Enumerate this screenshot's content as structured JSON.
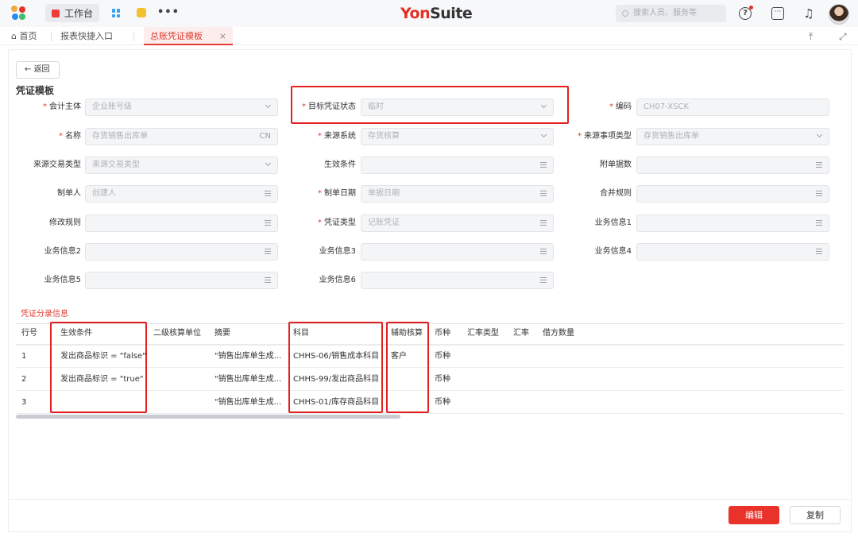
{
  "topbar": {
    "workbench": "工作台",
    "more": "•••",
    "brand_main": "Yon",
    "brand_sub": "Suite",
    "search_placeholder": "搜索人员、服务等"
  },
  "tabs": [
    {
      "label": "首页"
    },
    {
      "label": "报表快捷入口"
    },
    {
      "label": "总账凭证模板"
    }
  ],
  "page": {
    "back": "返回",
    "section_title": "凭证模板",
    "subsection_title": "凭证分录信息"
  },
  "form": [
    {
      "label": "会计主体",
      "required": true,
      "value": "企业账号级",
      "control": "select"
    },
    {
      "label": "目标凭证状态",
      "required": true,
      "value": "临时",
      "control": "select"
    },
    {
      "label": "编码",
      "required": true,
      "value": "CH07-XSCK",
      "control": "text"
    },
    {
      "label": "名称",
      "required": true,
      "value": "存货销售出库单",
      "suffix": "CN",
      "control": "text"
    },
    {
      "label": "来源系统",
      "required": true,
      "value": "存货核算",
      "control": "select"
    },
    {
      "label": "来源事项类型",
      "required": true,
      "value": "存货销售出库单",
      "control": "select"
    },
    {
      "label": "来源交易类型",
      "required": false,
      "value": "来源交易类型",
      "control": "select"
    },
    {
      "label": "生效条件",
      "required": false,
      "value": "",
      "control": "list"
    },
    {
      "label": "附单据数",
      "required": false,
      "value": "",
      "control": "list"
    },
    {
      "label": "制单人",
      "required": false,
      "value": "创建人",
      "control": "list"
    },
    {
      "label": "制单日期",
      "required": true,
      "value": "单据日期",
      "control": "list"
    },
    {
      "label": "合并规则",
      "required": false,
      "value": "",
      "control": "list"
    },
    {
      "label": "修改规则",
      "required": false,
      "value": "",
      "control": "list"
    },
    {
      "label": "凭证类型",
      "required": true,
      "value": "记账凭证",
      "control": "list"
    },
    {
      "label": "业务信息1",
      "required": false,
      "value": "",
      "control": "list"
    },
    {
      "label": "业务信息2",
      "required": false,
      "value": "",
      "control": "list"
    },
    {
      "label": "业务信息3",
      "required": false,
      "value": "",
      "control": "list"
    },
    {
      "label": "业务信息4",
      "required": false,
      "value": "",
      "control": "list"
    },
    {
      "label": "业务信息5",
      "required": false,
      "value": "",
      "control": "list"
    },
    {
      "label": "业务信息6",
      "required": false,
      "value": "",
      "control": "list"
    }
  ],
  "table": {
    "headers": [
      "行号",
      "生效条件",
      "二级核算单位",
      "摘要",
      "科目",
      "辅助核算",
      "币种",
      "汇率类型",
      "汇率",
      "借方数量"
    ],
    "rows": [
      [
        "1",
        "发出商品标识 = \"false\"",
        "",
        "\"销售出库单生成...",
        "CHHS-06/销售成本科目",
        "客户",
        "币种"
      ],
      [
        "2",
        "发出商品标识 = \"true\"",
        "",
        "\"销售出库单生成...",
        "CHHS-99/发出商品科目",
        "",
        "币种"
      ],
      [
        "3",
        "",
        "",
        "\"销售出库单生成...",
        "CHHS-01/库存商品科目",
        "",
        "币种"
      ]
    ]
  },
  "footer": {
    "edit": "编辑",
    "copy": "复制"
  },
  "colors": {
    "accent": "#e8322a",
    "highlight_box": "#e52020"
  }
}
